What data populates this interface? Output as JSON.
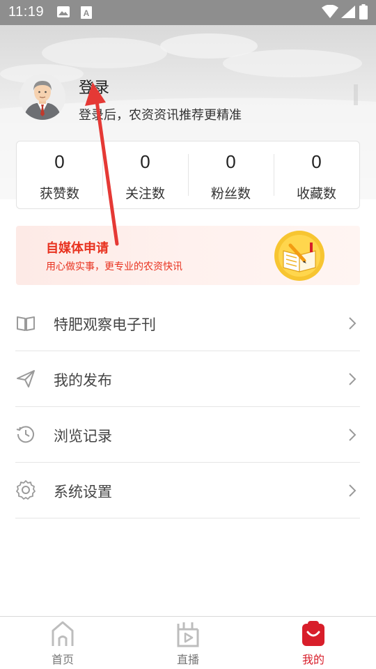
{
  "status_bar": {
    "time": "11:19",
    "icons": [
      "image-icon",
      "a-text-icon",
      "wifi-icon",
      "signal-icon",
      "battery-icon"
    ]
  },
  "profile": {
    "avatar_icon": "businessman-avatar",
    "login_label": "登录",
    "login_subtitle": "登录后，农资资讯推荐更精准"
  },
  "stats": [
    {
      "value": "0",
      "label": "获赞数"
    },
    {
      "value": "0",
      "label": "关注数"
    },
    {
      "value": "0",
      "label": "粉丝数"
    },
    {
      "value": "0",
      "label": "收藏数"
    }
  ],
  "banner": {
    "title": "自媒体申请",
    "subtitle": "用心做实事，更专业的农资快讯",
    "icon": "book-pencil-badge-icon",
    "accent_color": "#e8321f"
  },
  "menu": [
    {
      "label": "特肥观察电子刊",
      "icon": "book-icon"
    },
    {
      "label": "我的发布",
      "icon": "paper-plane-icon"
    },
    {
      "label": "浏览记录",
      "icon": "history-clock-icon"
    },
    {
      "label": "系统设置",
      "icon": "gear-icon"
    }
  ],
  "bottom_nav": [
    {
      "label": "首页",
      "icon": "home-icon",
      "active": false
    },
    {
      "label": "直播",
      "icon": "live-play-icon",
      "active": false
    },
    {
      "label": "我的",
      "icon": "profile-icon",
      "active": true
    }
  ],
  "colors": {
    "active_tab": "#d81e2a",
    "annotation_arrow": "#e53935"
  }
}
